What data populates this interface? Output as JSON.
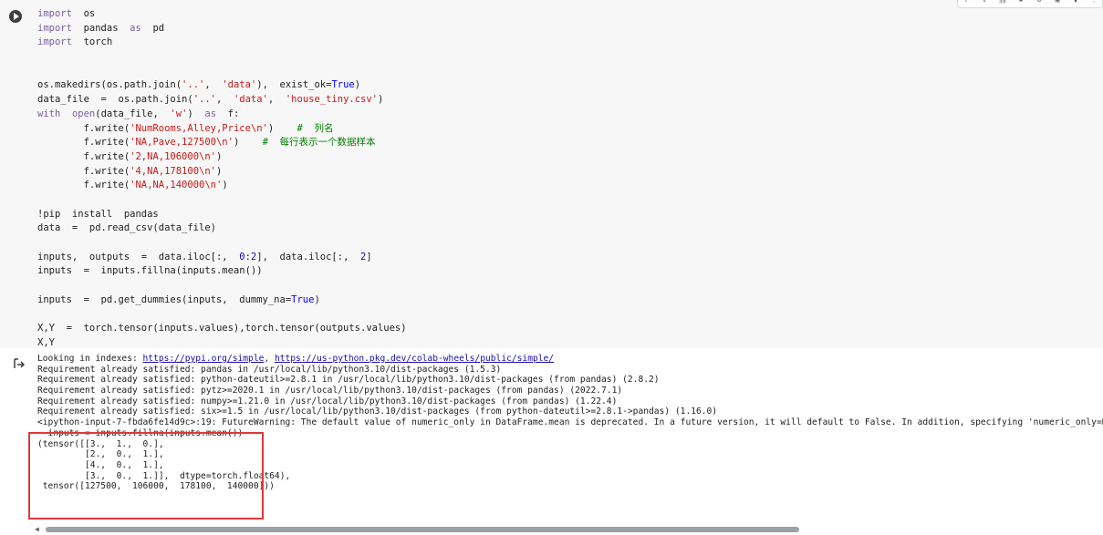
{
  "code_lines": [
    [
      {
        "t": "import",
        "c": "kw"
      },
      {
        "t": "  os",
        "c": "fn"
      }
    ],
    [
      {
        "t": "import",
        "c": "kw"
      },
      {
        "t": "  pandas  ",
        "c": "fn"
      },
      {
        "t": "as",
        "c": "kw"
      },
      {
        "t": "  pd",
        "c": "fn"
      }
    ],
    [
      {
        "t": "import",
        "c": "kw"
      },
      {
        "t": "  torch",
        "c": "fn"
      }
    ],
    [],
    [],
    [
      {
        "t": "os.makedirs(os.path.join(",
        "c": "fn"
      },
      {
        "t": "'..'",
        "c": "str"
      },
      {
        "t": ",  ",
        "c": "fn"
      },
      {
        "t": "'data'",
        "c": "str"
      },
      {
        "t": "),  exist_ok=",
        "c": "fn"
      },
      {
        "t": "True",
        "c": "bool"
      },
      {
        "t": ")",
        "c": "fn"
      }
    ],
    [
      {
        "t": "data_file  =  os.path.join(",
        "c": "fn"
      },
      {
        "t": "'..'",
        "c": "str"
      },
      {
        "t": ",  ",
        "c": "fn"
      },
      {
        "t": "'data'",
        "c": "str"
      },
      {
        "t": ",  ",
        "c": "fn"
      },
      {
        "t": "'house_tiny.csv'",
        "c": "str"
      },
      {
        "t": ")",
        "c": "fn"
      }
    ],
    [
      {
        "t": "with",
        "c": "kw"
      },
      {
        "t": "  ",
        "c": "fn"
      },
      {
        "t": "open",
        "c": "kw"
      },
      {
        "t": "(data_file,  ",
        "c": "fn"
      },
      {
        "t": "'w'",
        "c": "str"
      },
      {
        "t": ")  ",
        "c": "fn"
      },
      {
        "t": "as",
        "c": "kw"
      },
      {
        "t": "  f:",
        "c": "fn"
      }
    ],
    [
      {
        "t": "        f.write(",
        "c": "fn"
      },
      {
        "t": "'NumRooms,Alley,Price\\n'",
        "c": "str"
      },
      {
        "t": ")    ",
        "c": "fn"
      },
      {
        "t": "#  列名",
        "c": "cmt"
      }
    ],
    [
      {
        "t": "        f.write(",
        "c": "fn"
      },
      {
        "t": "'NA,Pave,127500\\n'",
        "c": "str"
      },
      {
        "t": ")    ",
        "c": "fn"
      },
      {
        "t": "#  每行表示一个数据样本",
        "c": "cmt"
      }
    ],
    [
      {
        "t": "        f.write(",
        "c": "fn"
      },
      {
        "t": "'2,NA,106000\\n'",
        "c": "str"
      },
      {
        "t": ")",
        "c": "fn"
      }
    ],
    [
      {
        "t": "        f.write(",
        "c": "fn"
      },
      {
        "t": "'4,NA,178100\\n'",
        "c": "str"
      },
      {
        "t": ")",
        "c": "fn"
      }
    ],
    [
      {
        "t": "        f.write(",
        "c": "fn"
      },
      {
        "t": "'NA,NA,140000\\n'",
        "c": "str"
      },
      {
        "t": ")",
        "c": "fn"
      }
    ],
    [],
    [
      {
        "t": "!pip  install  pandas",
        "c": "fn"
      }
    ],
    [
      {
        "t": "data  =  pd.read_csv(data_file)",
        "c": "fn"
      }
    ],
    [],
    [
      {
        "t": "inputs,  outputs  =  data.iloc[:,  ",
        "c": "fn"
      },
      {
        "t": "0",
        "c": "num"
      },
      {
        "t": ":",
        "c": "fn"
      },
      {
        "t": "2",
        "c": "num"
      },
      {
        "t": "],  data.iloc[:,  ",
        "c": "fn"
      },
      {
        "t": "2",
        "c": "num"
      },
      {
        "t": "]",
        "c": "fn"
      }
    ],
    [
      {
        "t": "inputs  =  inputs.fillna(inputs.mean())",
        "c": "fn"
      }
    ],
    [],
    [
      {
        "t": "inputs  =  pd.get_dummies(inputs,  dummy_na=",
        "c": "fn"
      },
      {
        "t": "True",
        "c": "bool"
      },
      {
        "t": ")",
        "c": "fn"
      }
    ],
    [],
    [
      {
        "t": "X,Y  =  torch.tensor(inputs.values),torch.tensor(outputs.values)",
        "c": "fn"
      }
    ],
    [
      {
        "t": "X,Y",
        "c": "fn"
      }
    ]
  ],
  "output_lines": [
    [
      {
        "t": "Looking in indexes: "
      },
      {
        "t": "https://pypi.org/simple",
        "link": true
      },
      {
        "t": ", "
      },
      {
        "t": "https://us-python.pkg.dev/colab-wheels/public/simple/",
        "link": true
      }
    ],
    [
      {
        "t": "Requirement already satisfied: pandas in /usr/local/lib/python3.10/dist-packages (1.5.3)"
      }
    ],
    [
      {
        "t": "Requirement already satisfied: python-dateutil>=2.8.1 in /usr/local/lib/python3.10/dist-packages (from pandas) (2.8.2)"
      }
    ],
    [
      {
        "t": "Requirement already satisfied: pytz>=2020.1 in /usr/local/lib/python3.10/dist-packages (from pandas) (2022.7.1)"
      }
    ],
    [
      {
        "t": "Requirement already satisfied: numpy>=1.21.0 in /usr/local/lib/python3.10/dist-packages (from pandas) (1.22.4)"
      }
    ],
    [
      {
        "t": "Requirement already satisfied: six>=1.5 in /usr/local/lib/python3.10/dist-packages (from python-dateutil>=2.8.1->pandas) (1.16.0)"
      }
    ],
    [
      {
        "t": "<ipython-input-7-fbda6fe14d9c>:19: FutureWarning: The default value of numeric_only in DataFrame.mean is deprecated. In a future version, it will default to False. In addition, specifying 'numeric_only=None' i"
      }
    ],
    [
      {
        "t": "  inputs = inputs.fillna(inputs.mean())"
      }
    ],
    [
      {
        "t": "(tensor([[3.,  1.,  0.],"
      }
    ],
    [
      {
        "t": "         [2.,  0.,  1.],"
      }
    ],
    [
      {
        "t": "         [4.,  0.,  1.],"
      }
    ],
    [
      {
        "t": "         [3.,  0.,  1.]],  dtype=torch.float64),"
      }
    ],
    [
      {
        "t": " tensor([127500,  106000,  178100,  140000]))"
      }
    ]
  ],
  "colors": {
    "highlight_box": "#e0383a",
    "keyword": "#795da3",
    "string": "#c41a16",
    "comment": "#008000",
    "link": "#1a0dab"
  },
  "icons": {
    "run": "play-icon",
    "output": "output-arrow-icon",
    "toolbar": [
      "arrow-up-icon",
      "arrow-down-icon",
      "link-icon",
      "comment-icon",
      "settings-icon",
      "mirror-icon",
      "delete-icon",
      "more-icon"
    ]
  }
}
